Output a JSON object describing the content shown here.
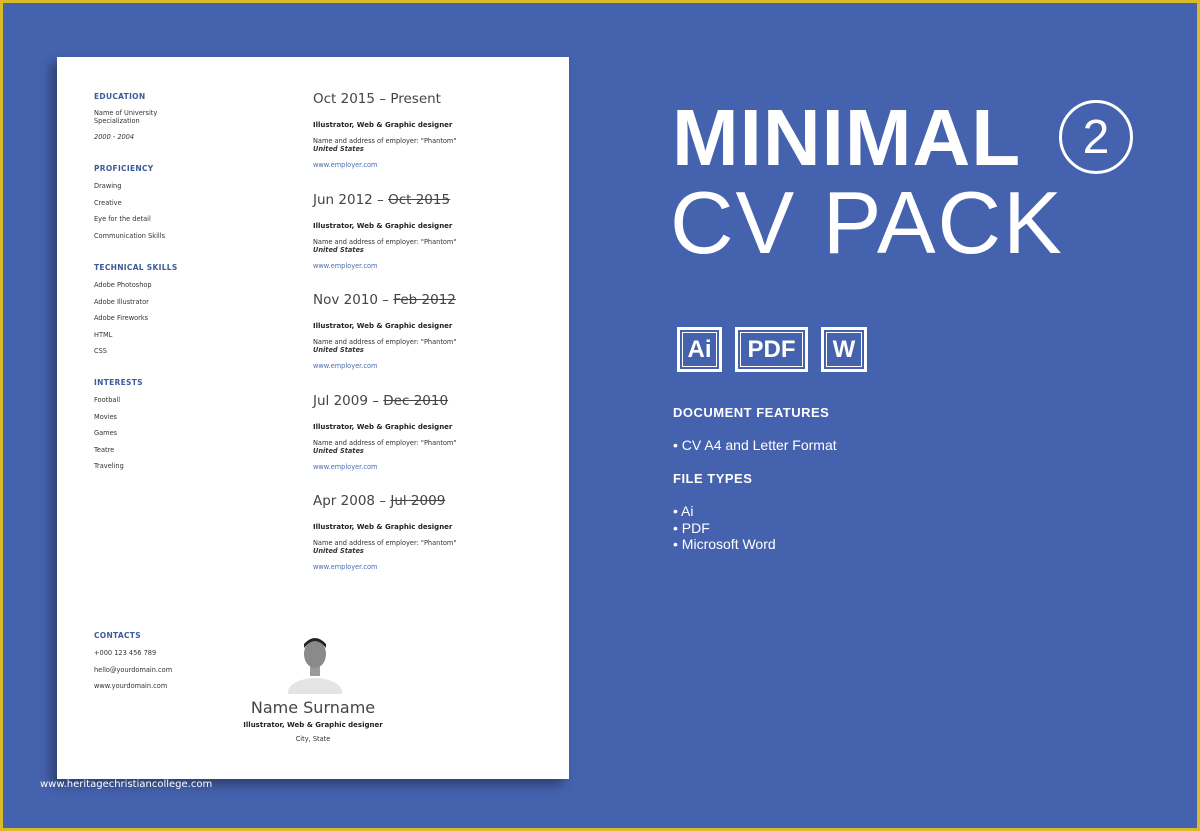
{
  "resume": {
    "education": {
      "heading": "EDUCATION",
      "lines": [
        "Name of University",
        "Specialization"
      ],
      "years": "2000 - 2004"
    },
    "proficiency": {
      "heading": "PROFICIENCY",
      "items": [
        "Drawing",
        "Creative",
        "Eye for the detail",
        "Communication Skills"
      ]
    },
    "technical": {
      "heading": "TECHNICAL SKILLS",
      "items": [
        "Adobe Photoshop",
        "Adobe Illustrator",
        "Adobe Fireworks",
        "HTML",
        "CSS"
      ]
    },
    "interests": {
      "heading": "INTERESTS",
      "items": [
        "Football",
        "Movies",
        "Games",
        "Teatre",
        "Traveling"
      ]
    },
    "contacts": {
      "heading": "CONTACTS",
      "items": [
        "+000 123 456 789",
        "hello@yourdomain.com",
        "www.yourdomain.com"
      ]
    },
    "experience": [
      {
        "start": "Oct 2015 – ",
        "end": "Present",
        "struck": false,
        "title": "Illustrator, Web & Graphic designer",
        "address": "Name and address of employer: \"Phantom\"",
        "country": "United States",
        "url": "www.employer.com"
      },
      {
        "start": "Jun 2012 – ",
        "end": "Oct 2015",
        "struck": true,
        "title": "Illustrator, Web & Graphic designer",
        "address": "Name and address of employer: \"Phantom\"",
        "country": "United States",
        "url": "www.employer.com"
      },
      {
        "start": "Nov 2010 – ",
        "end": "Feb 2012",
        "struck": true,
        "title": "Illustrator, Web & Graphic designer",
        "address": "Name and address of employer: \"Phantom\"",
        "country": "United States",
        "url": "www.employer.com"
      },
      {
        "start": "Jul 2009 – ",
        "end": "Dec 2010 ",
        "struck": true,
        "title": "Illustrator, Web & Graphic designer",
        "address": "Name and address of employer: \"Phantom\"",
        "country": "United States",
        "url": "www.employer.com"
      },
      {
        "start": "Apr 2008 – ",
        "end": "Jul 2009 ",
        "struck": true,
        "title": "Illustrator, Web & Graphic designer",
        "address": "Name and address of employer: \"Phantom\"",
        "country": "United States",
        "url": "www.employer.com"
      }
    ],
    "name": "Name Surname",
    "role": "Illustrator, Web & Graphic designer",
    "location": "City, State"
  },
  "promo": {
    "title_bold": "MINIMAL",
    "number": "2",
    "title_thin": "CV PACK",
    "formats": [
      "Ai",
      "PDF",
      "W"
    ],
    "features_heading": "DOCUMENT FEATURES",
    "features": [
      "• CV A4 and Letter Format"
    ],
    "filetypes_heading": "FILE TYPES",
    "filetypes": [
      "• Ai",
      "• PDF",
      "• Microsoft Word"
    ]
  },
  "watermark": "www.heritagechristiancollege.com",
  "colors": {
    "background": "#4562ae",
    "border": "#d9bb2a",
    "accent": "#3d5a9a"
  }
}
